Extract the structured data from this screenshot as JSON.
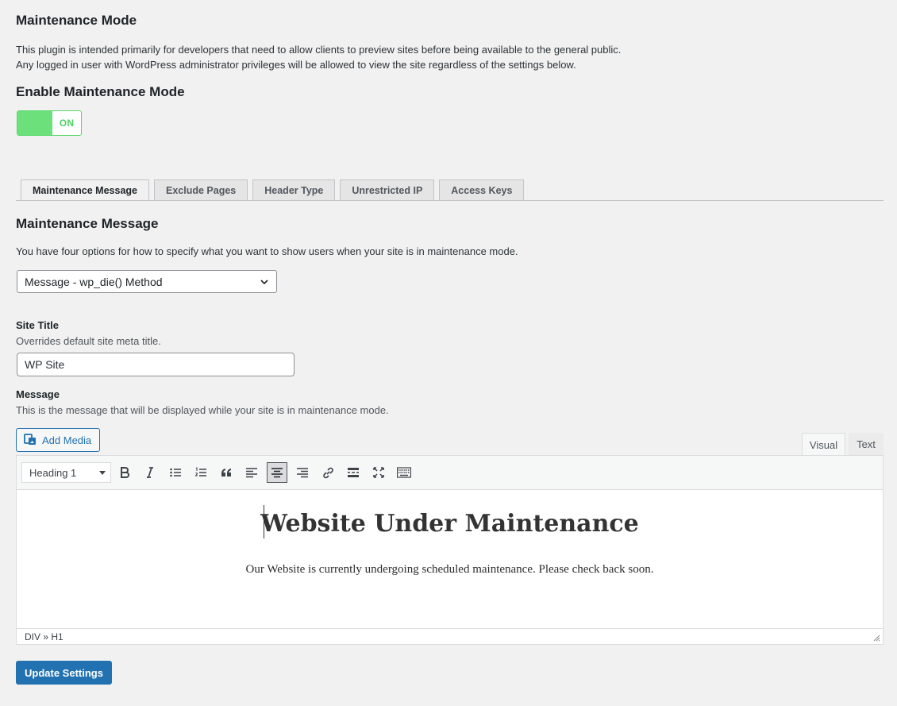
{
  "page": {
    "title": "Maintenance Mode",
    "intro_line1": "This plugin is intended primarily for developers that need to allow clients to preview sites before being available to the general public.",
    "intro_line2": "Any logged in user with WordPress administrator privileges will be allowed to view the site regardless of the settings below."
  },
  "enable": {
    "heading": "Enable Maintenance Mode",
    "state_label": "ON",
    "color_on": "#6be07b"
  },
  "tabs": [
    {
      "label": "Maintenance Message",
      "active": true
    },
    {
      "label": "Exclude Pages",
      "active": false
    },
    {
      "label": "Header Type",
      "active": false
    },
    {
      "label": "Unrestricted IP",
      "active": false
    },
    {
      "label": "Access Keys",
      "active": false
    }
  ],
  "message_section": {
    "heading": "Maintenance Message",
    "description": "You have four options for how to specify what you want to show users when your site is in maintenance mode.",
    "method_select": {
      "selected": "Message - wp_die() Method"
    }
  },
  "site_title": {
    "label": "Site Title",
    "help": "Overrides default site meta title.",
    "value": "WP Site"
  },
  "message": {
    "label": "Message",
    "help": "This is the message that will be displayed while your site is in maintenance mode."
  },
  "editor": {
    "add_media_label": "Add Media",
    "tab_visual": "Visual",
    "tab_text": "Text",
    "format_selected": "Heading 1",
    "toolbar_icons": [
      "bold-icon",
      "italic-icon",
      "bulleted-list-icon",
      "numbered-list-icon",
      "blockquote-icon",
      "align-left-icon",
      "align-center-icon",
      "align-right-icon",
      "link-icon",
      "read-more-icon",
      "fullscreen-icon",
      "toolbar-toggle-icon"
    ],
    "content_heading": "Website Under Maintenance",
    "content_paragraph": "Our Website is currently undergoing scheduled maintenance. Please check back soon.",
    "path": "DIV » H1"
  },
  "actions": {
    "submit_label": "Update Settings",
    "accent": "#2271b1"
  }
}
